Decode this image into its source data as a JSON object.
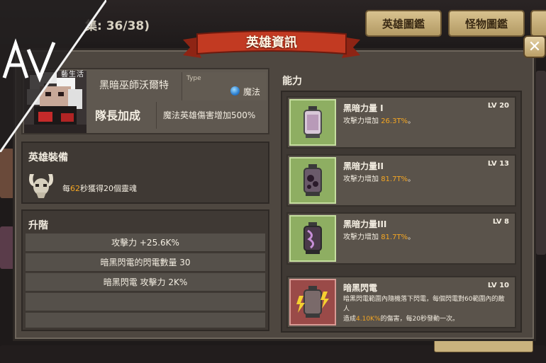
{
  "header": {
    "collection_counter": "集: 36/38)",
    "tabs": [
      {
        "label": "英雄圖鑑"
      },
      {
        "label": "怪物圖鑑"
      }
    ]
  },
  "watermark": {
    "text": "藝生活"
  },
  "dialog": {
    "title": "英雄資訊",
    "close_label": "✕"
  },
  "hero": {
    "name": "黑暗巫師沃爾特",
    "type_label": "Type",
    "type_value": "魔法",
    "leader_title": "隊長加成",
    "leader_desc": "魔法英雄傷害增加500%"
  },
  "equipment": {
    "title": "英雄裝備",
    "desc_prefix": "每",
    "desc_highlight": "62",
    "desc_suffix": "秒獲得20個靈魂"
  },
  "ascension": {
    "title": "升階",
    "stats": [
      "攻擊力 +25.6K%",
      "暗黑閃電的閃電數量 30",
      "暗黑閃電 攻擊力 2K%"
    ]
  },
  "abilities": {
    "title": "能力",
    "items": [
      {
        "name": "黑暗力量 I",
        "level": "LV 20",
        "desc_prefix": "攻擊力增加 ",
        "desc_value": "26.3T%",
        "desc_suffix": "。"
      },
      {
        "name": "黑暗力量II",
        "level": "LV 13",
        "desc_prefix": "攻擊力增加 ",
        "desc_value": "81.7T%",
        "desc_suffix": "。"
      },
      {
        "name": "黑暗力量III",
        "level": "LV 8",
        "desc_prefix": "攻擊力增加 ",
        "desc_value": "81.7T%",
        "desc_suffix": "。"
      },
      {
        "name": "暗黑閃電",
        "level": "LV 10",
        "desc_line1": "暗黑閃電範圍內隨機落下閃電，每個閃電對60範圍內的敵人",
        "desc_line2_prefix": "造成",
        "desc_value": "4.10K%",
        "desc_line2_suffix": "的傷害，每20秒發動一次。"
      }
    ]
  },
  "colors": {
    "panel_bg": "#4e4740",
    "ribbon_red": "#c23a22",
    "highlight_orange": "#f4a623",
    "ability_green": "#8eae62",
    "ability_red": "#9a4a48"
  },
  "icons": {
    "type_icon": "magic-orb-icon",
    "equipment_icon": "horned-skull-icon",
    "ability_icons": [
      "dark-lantern-icon",
      "dark-lantern-icon",
      "dark-lantern-icon",
      "lightning-lantern-icon"
    ],
    "close_icon": "close-icon"
  }
}
